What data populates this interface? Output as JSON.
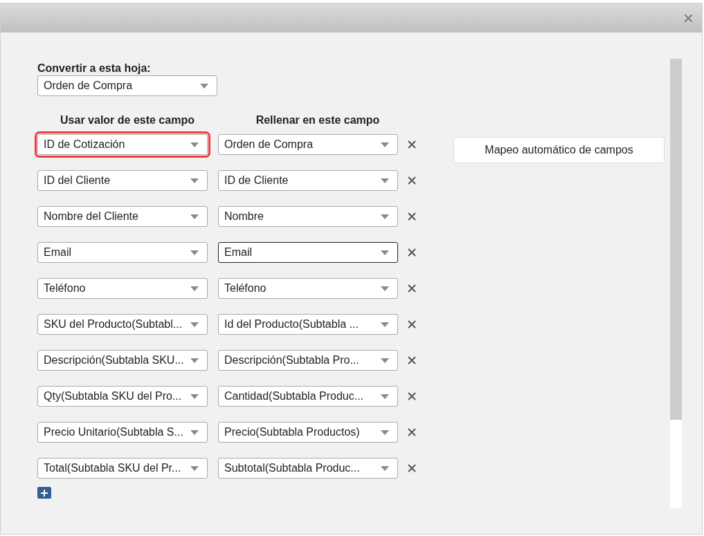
{
  "dialog": {
    "close_label": "×"
  },
  "sheet": {
    "label": "Convertir a esta hoja:",
    "value": "Orden de Compra"
  },
  "columns": {
    "source": "Usar valor de este campo",
    "target": "Rellenar en este campo"
  },
  "mappings": [
    {
      "source": "ID de Cotización",
      "target": "Orden de Compra",
      "highlighted": true,
      "focused": false
    },
    {
      "source": "ID del Cliente",
      "target": "ID de Cliente",
      "highlighted": false,
      "focused": false
    },
    {
      "source": "Nombre del Cliente",
      "target": "Nombre",
      "highlighted": false,
      "focused": false
    },
    {
      "source": "Email",
      "target": "Email",
      "highlighted": false,
      "focused": true
    },
    {
      "source": "Teléfono",
      "target": "Teléfono",
      "highlighted": false,
      "focused": false
    },
    {
      "source": "SKU del Producto(Subtabl...",
      "target": "Id del Producto(Subtabla ...",
      "highlighted": false,
      "focused": false
    },
    {
      "source": "Descripción(Subtabla SKU...",
      "target": "Descripción(Subtabla Pro...",
      "highlighted": false,
      "focused": false
    },
    {
      "source": "Qty(Subtabla SKU del Pro...",
      "target": "Cantidad(Subtabla Produc...",
      "highlighted": false,
      "focused": false
    },
    {
      "source": "Precio Unitario(Subtabla S...",
      "target": "Precio(Subtabla Productos)",
      "highlighted": false,
      "focused": false
    },
    {
      "source": "Total(Subtabla SKU del Pr...",
      "target": "Subtotal(Subtabla Produc...",
      "highlighted": false,
      "focused": false
    }
  ],
  "auto_map_button": "Mapeo automático de campos"
}
